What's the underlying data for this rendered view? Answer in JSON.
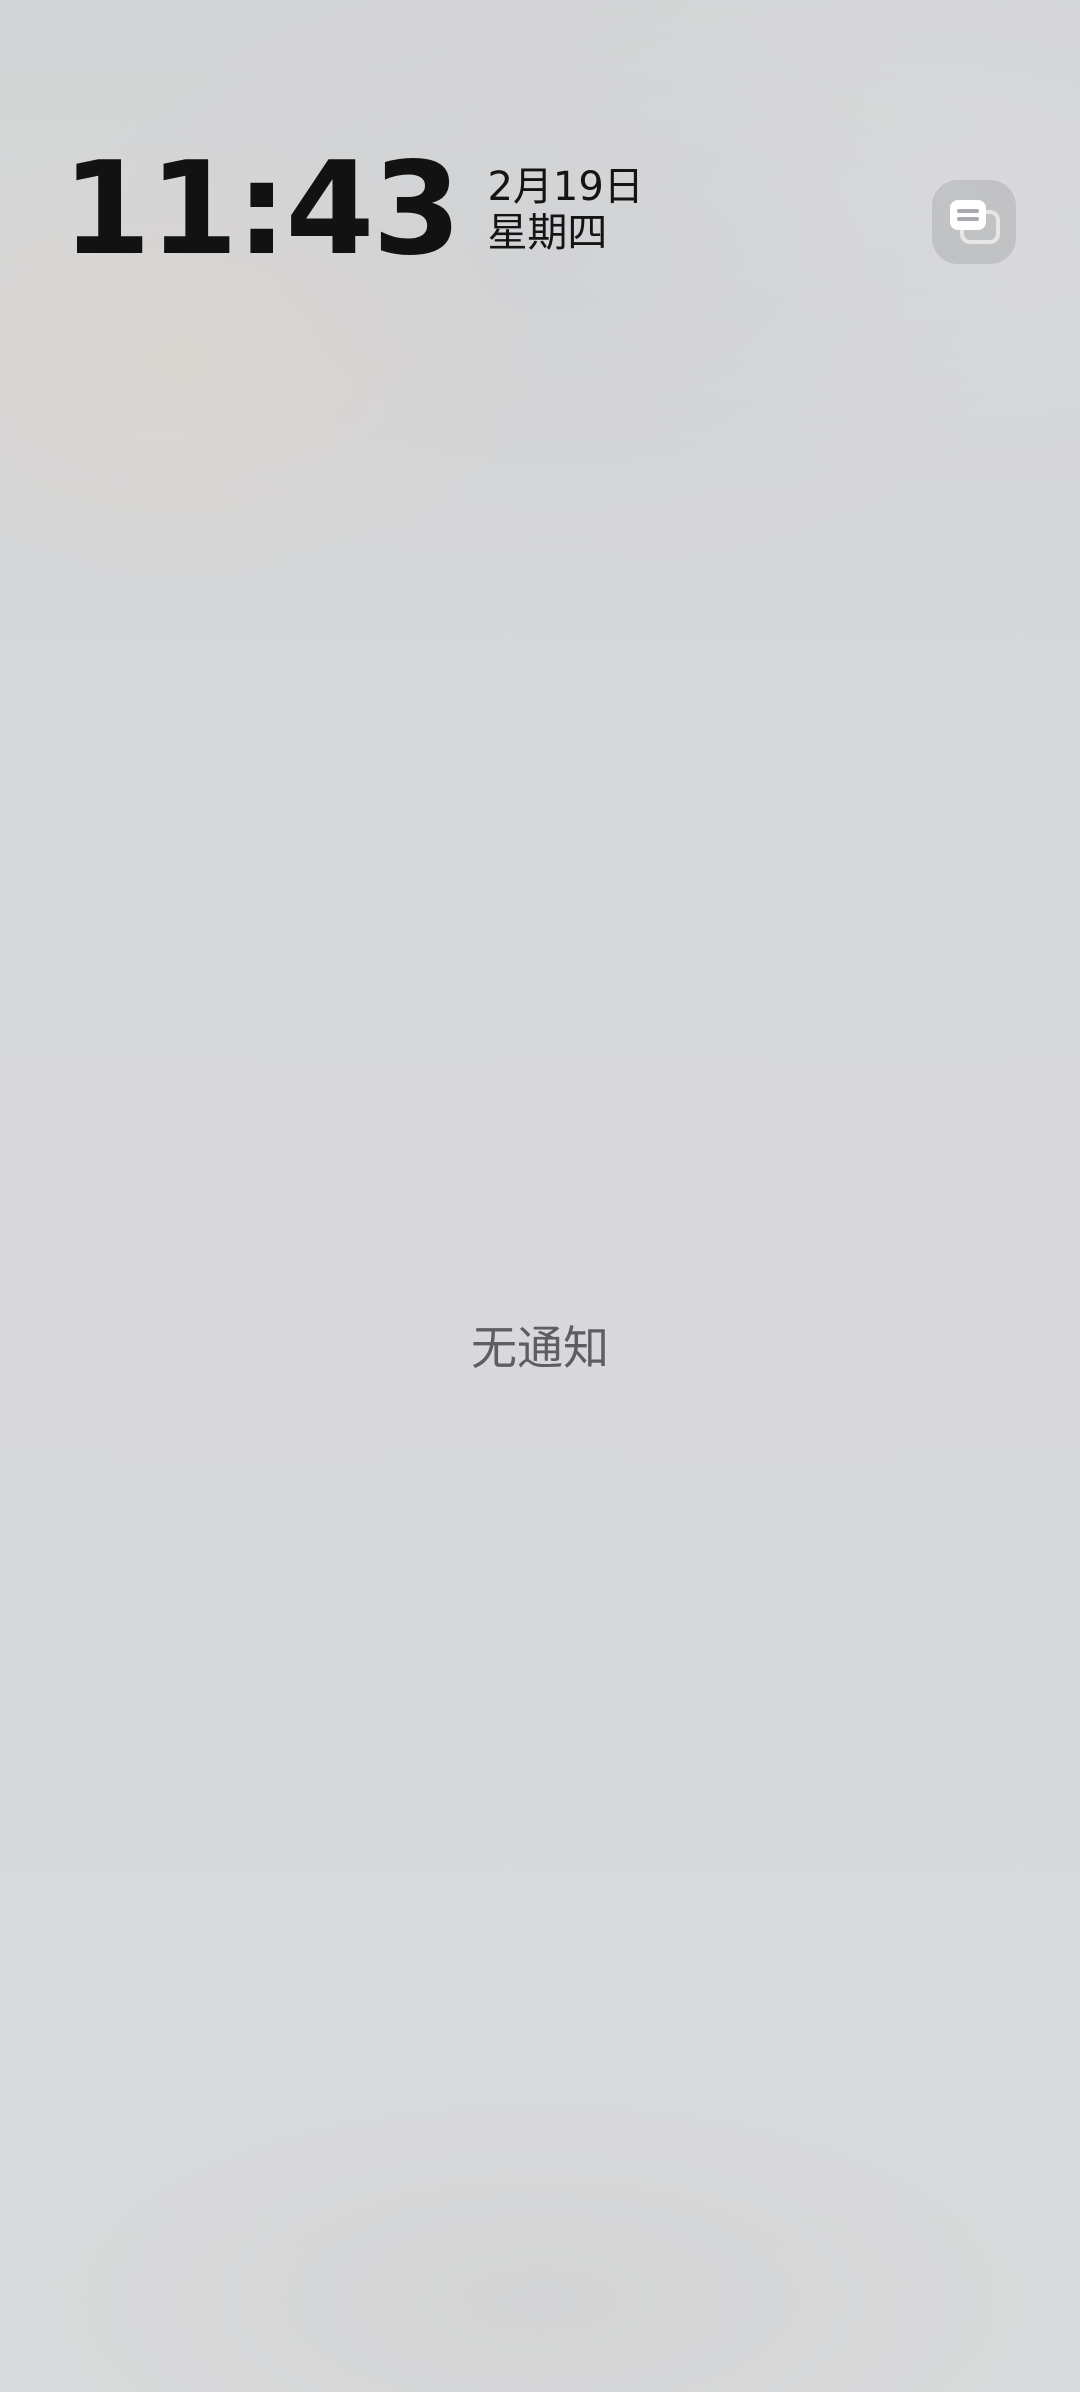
{
  "lockscreen": {
    "time": "11:43",
    "date": "2月19日",
    "weekday": "星期四"
  },
  "notifications": {
    "empty_text": "无通知",
    "toggle_icon": "notification-cards-icon"
  },
  "colors": {
    "background": "#d7d8da",
    "clock_text": "#121212",
    "empty_text": "#5d5e60"
  }
}
